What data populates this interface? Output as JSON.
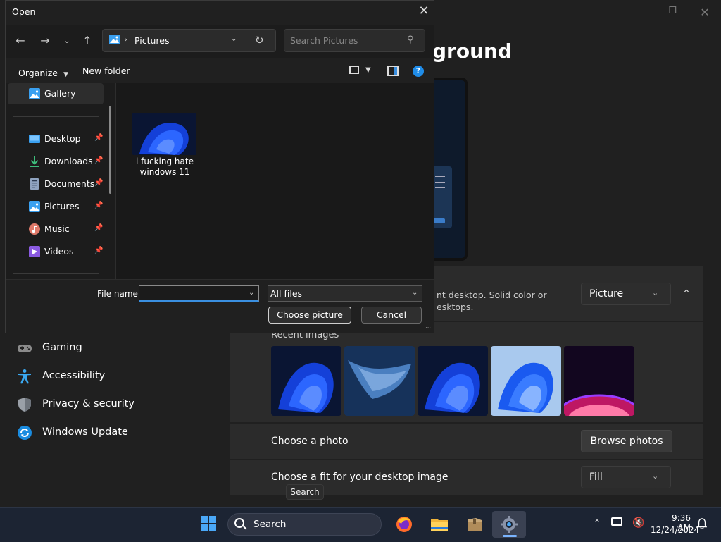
{
  "settings": {
    "page_title": "ground",
    "background_desc": "nt desktop. Solid color or\nesktops.",
    "background_type": "Picture",
    "recent_images_label": "Recent images",
    "choose_photo_label": "Choose a photo",
    "browse_photos_label": "Browse photos",
    "fit_label": "Choose a fit for your desktop image",
    "fit_value": "Fill",
    "nav": [
      {
        "label": "Gaming",
        "icon": "gamepad-icon"
      },
      {
        "label": "Accessibility",
        "icon": "accessibility-icon"
      },
      {
        "label": "Privacy & security",
        "icon": "shield-icon"
      },
      {
        "label": "Windows Update",
        "icon": "update-icon"
      }
    ]
  },
  "dialog": {
    "title": "Open",
    "address": "Pictures",
    "search_placeholder": "Search Pictures",
    "organize_label": "Organize",
    "new_folder_label": "New folder",
    "sidebar": [
      {
        "label": "Gallery",
        "icon": "gallery-icon",
        "pinned": false
      },
      {
        "label": "Desktop",
        "icon": "desktop-icon",
        "pinned": true
      },
      {
        "label": "Downloads",
        "icon": "download-icon",
        "pinned": true
      },
      {
        "label": "Documents",
        "icon": "documents-icon",
        "pinned": true
      },
      {
        "label": "Pictures",
        "icon": "pictures-icon",
        "pinned": true
      },
      {
        "label": "Music",
        "icon": "music-icon",
        "pinned": true
      },
      {
        "label": "Videos",
        "icon": "videos-icon",
        "pinned": true
      }
    ],
    "files": [
      {
        "name": "i fucking hate windows 11"
      }
    ],
    "file_name_label": "File name:",
    "file_name_value": "",
    "file_type": "All files",
    "choose_button": "Choose picture",
    "cancel_button": "Cancel"
  },
  "tooltip": "Search",
  "taskbar": {
    "search_label": "Search",
    "time": "9:36 AM",
    "date": "12/24/2024"
  },
  "colors": {
    "accent": "#3a8fe0",
    "window_bg": "#202020",
    "card_bg": "#2b2b2b",
    "taskbar_bg": "#1c2433"
  }
}
